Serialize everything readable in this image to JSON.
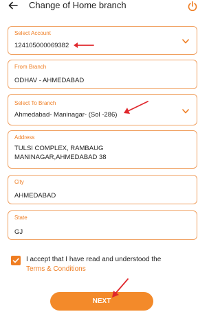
{
  "header": {
    "title": "Change of Home branch",
    "back_icon": "arrow-left-icon",
    "power_icon": "power-icon"
  },
  "fields": {
    "select_account": {
      "label": "Select Account",
      "value": "124105000069382"
    },
    "from_branch": {
      "label": "From Branch",
      "value": "ODHAV - AHMEDABAD"
    },
    "select_to_branch": {
      "label": "Select To Branch",
      "value": "Ahmedabad- Maninagar- (Sol -286)"
    },
    "address": {
      "label": "Address",
      "line1": "TULSI COMPLEX, RAMBAUG",
      "line2": "MANINAGAR,AHMEDABAD 38"
    },
    "city": {
      "label": "City",
      "value": "AHMEDABAD"
    },
    "state": {
      "label": "State",
      "value": "GJ"
    }
  },
  "consent": {
    "checked": true,
    "text": "I accept that I have read and understood the",
    "link": "Terms & Conditions"
  },
  "next_button": {
    "label": "NEXT"
  },
  "colors": {
    "accent": "#ef7d22",
    "border": "#f0a060",
    "annotation": "#e0282d"
  }
}
